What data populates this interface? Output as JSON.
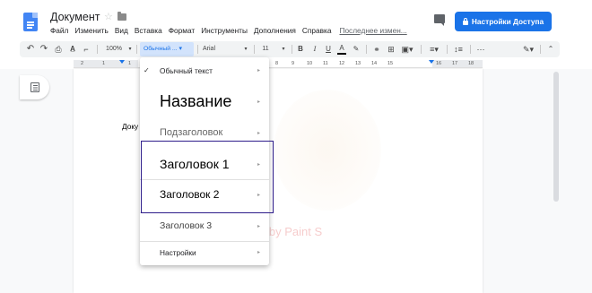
{
  "header": {
    "doc_title": "Документ",
    "share_label": "Настройки Доступа",
    "icons": [
      "docs-logo-icon",
      "star-icon",
      "folder-icon",
      "comment-icon",
      "lock-icon"
    ]
  },
  "menu": {
    "items": [
      "Файл",
      "Изменить",
      "Вид",
      "Вставка",
      "Формат",
      "Инструменты",
      "Дополнения",
      "Справка"
    ],
    "last_edit": "Последнее измен..."
  },
  "toolbar": {
    "zoom": "100%",
    "style": "Обычный ...",
    "font": "Arial",
    "font_size": "11",
    "bold": "B",
    "italic": "I",
    "underline": "U",
    "text_color": "A"
  },
  "ruler": {
    "ticks": [
      "2",
      "1",
      "1",
      "2",
      "8",
      "9",
      "10",
      "11",
      "12",
      "13",
      "14",
      "15",
      "16",
      "17",
      "18"
    ]
  },
  "document": {
    "text": "Доку"
  },
  "style_menu": {
    "items": [
      {
        "label": "Обычный текст",
        "checked": true
      },
      {
        "label": "Название"
      },
      {
        "label": "Подзаголовок"
      },
      {
        "label": "Заголовок 1"
      },
      {
        "label": "Заголовок 2"
      },
      {
        "label": "Заголовок 3"
      },
      {
        "label": "Настройки"
      }
    ]
  },
  "watermark": "Created by Paint S",
  "colors": {
    "accent": "#1a73e8",
    "highlight_border": "#2e1d8a",
    "toolbar_bg": "#f1f3f4"
  }
}
